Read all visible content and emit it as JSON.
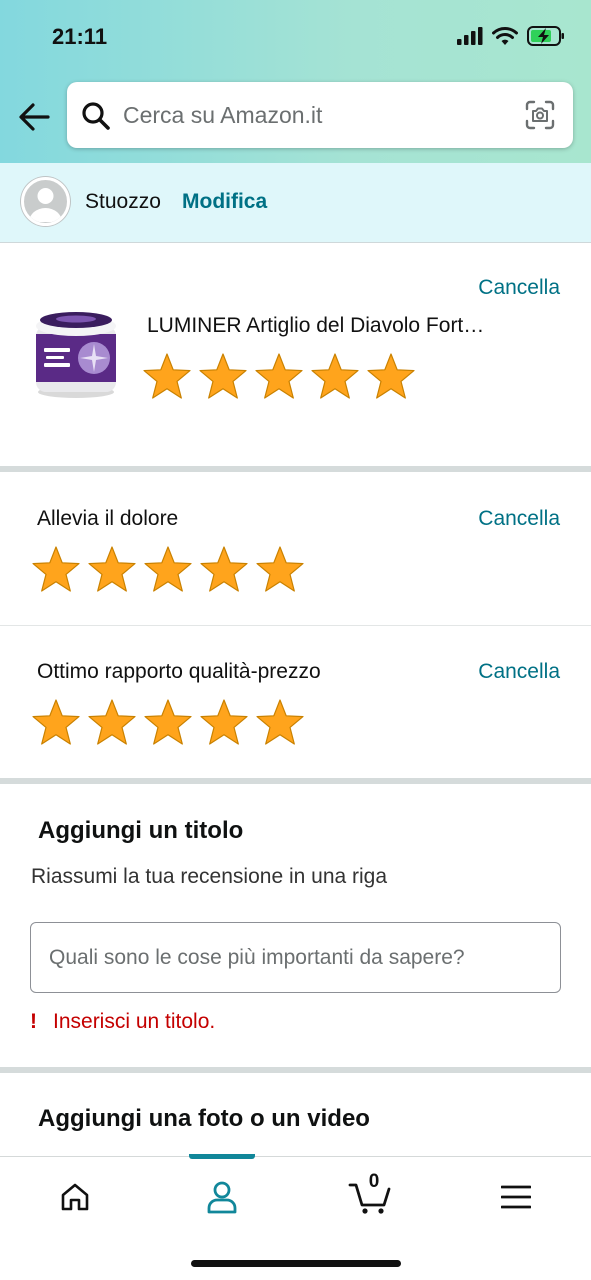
{
  "status_bar": {
    "time": "21:11"
  },
  "header": {
    "back_icon": "arrow-left-icon",
    "search": {
      "placeholder": "Cerca su Amazon.it",
      "value": ""
    }
  },
  "profile": {
    "name": "Stuozzo",
    "edit_label": "Modifica"
  },
  "product": {
    "title": "LUMINER Artiglio del Diavolo Fort…",
    "cancel_label": "Cancella",
    "rating": 5,
    "max_rating": 5
  },
  "attributes": [
    {
      "label": "Allevia il dolore",
      "cancel_label": "Cancella",
      "rating": 5
    },
    {
      "label": "Ottimo rapporto qualità-prezzo",
      "cancel_label": "Cancella",
      "rating": 5
    }
  ],
  "title_section": {
    "heading": "Aggiungi un titolo",
    "subtext": "Riassumi la tua recensione in una riga",
    "input_placeholder": "Quali sono le cose più importanti da sapere?",
    "input_value": "",
    "error_mark": "!",
    "error_text": "Inserisci un titolo."
  },
  "media_section": {
    "heading": "Aggiungi una foto o un video"
  },
  "tabbar": {
    "items": [
      {
        "name": "home",
        "icon": "home-icon"
      },
      {
        "name": "account",
        "icon": "person-icon",
        "active": true
      },
      {
        "name": "cart",
        "icon": "cart-icon",
        "count": "0"
      },
      {
        "name": "menu",
        "icon": "hamburger-menu-icon"
      }
    ]
  },
  "colors": {
    "link": "#007185",
    "star": "#ffa41c",
    "error": "#c40000",
    "active_tab": "#11879a"
  }
}
